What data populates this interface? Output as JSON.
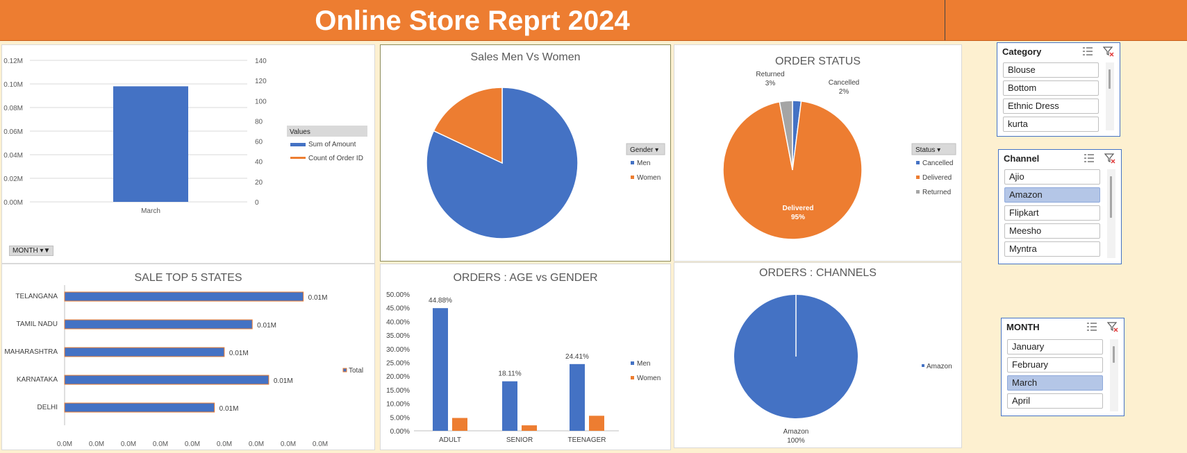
{
  "banner": {
    "title": "Online Store Reprt 2024"
  },
  "colors": {
    "blue": "#4472c4",
    "orange": "#ed7d31",
    "gray": "#a5a5a5"
  },
  "month_chart": {
    "left_ticks": [
      "0.12M",
      "0.10M",
      "0.08M",
      "0.06M",
      "0.04M",
      "0.02M",
      "0.00M"
    ],
    "right_ticks": [
      "140",
      "120",
      "100",
      "80",
      "60",
      "40",
      "20",
      "0"
    ],
    "legend_title": "Values",
    "legend": [
      "Sum of Amount",
      "Count of Order ID"
    ],
    "filter_label": "MONTH"
  },
  "sales_gender": {
    "title": "Sales Men Vs Women",
    "legend_title": "Gender",
    "legend": [
      "Men",
      "Women"
    ]
  },
  "order_status": {
    "title": "ORDER STATUS",
    "legend_title": "Status",
    "legend": [
      "Cancelled",
      "Delivered",
      "Returned"
    ],
    "labels": {
      "returned": "Returned",
      "returned_pct": "3%",
      "cancelled": "Cancelled",
      "cancelled_pct": "2%",
      "delivered": "Delivered",
      "delivered_pct": "95%"
    }
  },
  "top_states": {
    "title": "SALE TOP 5 STATES",
    "legend": "Total",
    "x_ticks": [
      "0.0M",
      "0.0M",
      "0.0M",
      "0.0M",
      "0.0M",
      "0.0M",
      "0.0M",
      "0.0M",
      "0.0M"
    ]
  },
  "age_gender": {
    "title": "ORDERS : AGE vs GENDER",
    "y_ticks": [
      "50.00%",
      "45.00%",
      "40.00%",
      "35.00%",
      "30.00%",
      "25.00%",
      "20.00%",
      "15.00%",
      "10.00%",
      "5.00%",
      "0.00%"
    ],
    "legend": [
      "Men",
      "Women"
    ]
  },
  "channels": {
    "title": "ORDERS : CHANNELS",
    "legend": "Amazon",
    "label": "Amazon",
    "pct": "100%"
  },
  "slicers": {
    "category": {
      "title": "Category",
      "items": [
        "Blouse",
        "Bottom",
        "Ethnic Dress",
        "kurta"
      ]
    },
    "channel": {
      "title": "Channel",
      "items": [
        "Ajio",
        "Amazon",
        "Flipkart",
        "Meesho",
        "Myntra"
      ],
      "selected": "Amazon"
    },
    "month": {
      "title": "MONTH",
      "items": [
        "January",
        "February",
        "March",
        "April"
      ],
      "selected": "March"
    }
  },
  "chart_data": [
    {
      "type": "bar",
      "categories": [
        "March"
      ],
      "series": [
        {
          "name": "Sum of Amount",
          "values": [
            0.098
          ],
          "unit": "M"
        },
        {
          "name": "Count of Order ID",
          "values": [
            0
          ]
        }
      ],
      "title": "",
      "ylim": [
        0,
        0.12
      ],
      "y2lim": [
        0,
        140
      ],
      "legend_position": "right"
    },
    {
      "type": "pie",
      "title": "Sales Men Vs Women",
      "categories": [
        "Men",
        "Women"
      ],
      "values": [
        82,
        18
      ],
      "legend_position": "right"
    },
    {
      "type": "pie",
      "title": "ORDER STATUS",
      "categories": [
        "Cancelled",
        "Delivered",
        "Returned"
      ],
      "values": [
        2,
        95,
        3
      ],
      "data_labels": [
        "2%",
        "95%",
        "3%"
      ],
      "legend_position": "right"
    },
    {
      "type": "bar",
      "orientation": "horizontal",
      "title": "SALE TOP 5 STATES",
      "categories": [
        "TELANGANA",
        "TAMIL NADU",
        "MAHARASHTRA",
        "KARNATAKA",
        "DELHI"
      ],
      "values": [
        0.0145,
        0.0114,
        0.0097,
        0.0124,
        0.0091
      ],
      "data_labels": [
        "0.01M",
        "0.01M",
        "0.01M",
        "0.01M",
        "0.01M"
      ],
      "series": [
        {
          "name": "Total"
        }
      ],
      "legend_position": "right"
    },
    {
      "type": "bar",
      "title": "ORDERS : AGE vs GENDER",
      "categories": [
        "ADULT",
        "SENIOR",
        "TEENAGER"
      ],
      "series": [
        {
          "name": "Men",
          "values": [
            44.88,
            18.11,
            24.41
          ]
        },
        {
          "name": "Women",
          "values": [
            4.7,
            2.0,
            5.5
          ]
        }
      ],
      "data_labels": [
        "44.88%",
        "18.11%",
        "24.41%"
      ],
      "ylim": [
        0,
        50
      ],
      "legend_position": "right"
    },
    {
      "type": "pie",
      "title": "ORDERS : CHANNELS",
      "categories": [
        "Amazon"
      ],
      "values": [
        100
      ],
      "data_labels": [
        "100%"
      ],
      "legend_position": "right"
    }
  ]
}
